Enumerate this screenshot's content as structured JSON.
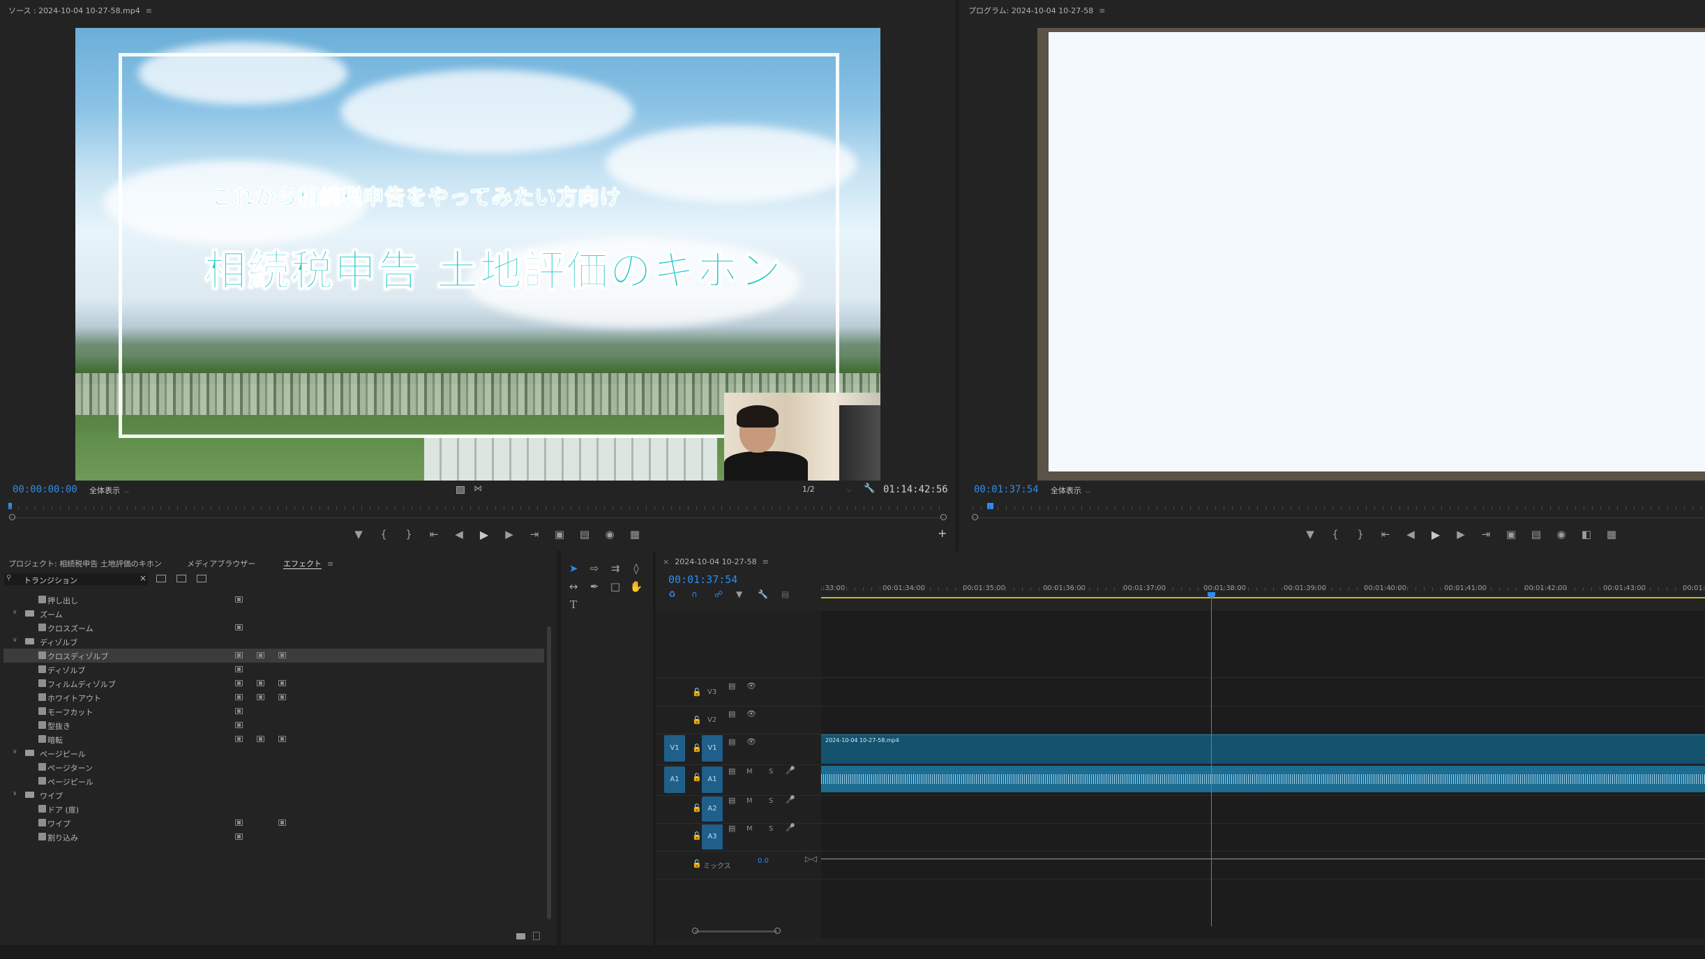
{
  "source_monitor": {
    "title": "ソース : 2024-10-04 10-27-58.mp4",
    "menu_icon": "≡",
    "timecode_in": "00:00:00:00",
    "fit": "全体表示",
    "resolution": "1/2",
    "timecode_duration": "01:14:42:56",
    "video": {
      "subtitle": "これから相続税申告をやってみたい方向け",
      "title": "相続税申告 土地評価のキホン"
    }
  },
  "program_monitor": {
    "title": "プログラム: 2024-10-04 10-27-58",
    "menu_icon": "≡",
    "timecode": "00:01:37:54",
    "fit": "全体表示"
  },
  "project_panel": {
    "tabs": [
      {
        "label": "プロジェクト: 相続税申告 土地評価のキホン"
      },
      {
        "label": "メディアブラウザー"
      },
      {
        "label": "エフェクト"
      }
    ],
    "menu_icon": "≡",
    "search_value": "トランジション",
    "items": [
      {
        "label": "押し出し",
        "type": "effect"
      },
      {
        "label": "ズーム",
        "type": "folder"
      },
      {
        "label": "クロスズーム",
        "type": "effect"
      },
      {
        "label": "ディゾルブ",
        "type": "folder"
      },
      {
        "label": "クロスディゾルブ",
        "type": "effect",
        "selected": true
      },
      {
        "label": "ディゾルブ",
        "type": "effect"
      },
      {
        "label": "フィルムディゾルブ",
        "type": "effect"
      },
      {
        "label": "ホワイトアウト",
        "type": "effect"
      },
      {
        "label": "モーフカット",
        "type": "effect"
      },
      {
        "label": "型抜き",
        "type": "effect"
      },
      {
        "label": "暗転",
        "type": "effect"
      },
      {
        "label": "ページピール",
        "type": "folder"
      },
      {
        "label": "ページターン",
        "type": "effect"
      },
      {
        "label": "ページピール",
        "type": "effect"
      },
      {
        "label": "ワイプ",
        "type": "folder"
      },
      {
        "label": "ドア (扉)",
        "type": "effect"
      },
      {
        "label": "ワイプ",
        "type": "effect"
      },
      {
        "label": "割り込み",
        "type": "effect"
      }
    ]
  },
  "timeline": {
    "close_glyph": "×",
    "sequence_name": "2024-10-04 10-27-58",
    "menu_icon": "≡",
    "timecode": "00:01:37:54",
    "ruler_labels": [
      ":33:00",
      "00:01:34:00",
      "00:01:35:00",
      "00:01:36:00",
      "00:01:37:00",
      "00:01:38:00",
      "00:01:39:00",
      "00:01:40:00",
      "00:01:41:00",
      "00:01:42:00",
      "00:01:43:00",
      "00:01:4"
    ],
    "tracks": {
      "v3": "V3",
      "v2": "V2",
      "v1": "V1",
      "a1": "A1",
      "a2": "A2",
      "a3": "A3",
      "src_v1": "V1",
      "src_a1": "A1",
      "mix_label": "ミックス",
      "mix_value": "0.0",
      "m": "M",
      "s": "S"
    },
    "clip_name": "2024-10-04 10-27-58.mp4"
  },
  "tool_text": "T",
  "colors": {
    "accent_blue": "#2d8ceb",
    "clip_video": "#14526e",
    "clip_audio": "#1d6d93",
    "panel_bg": "#232323"
  }
}
